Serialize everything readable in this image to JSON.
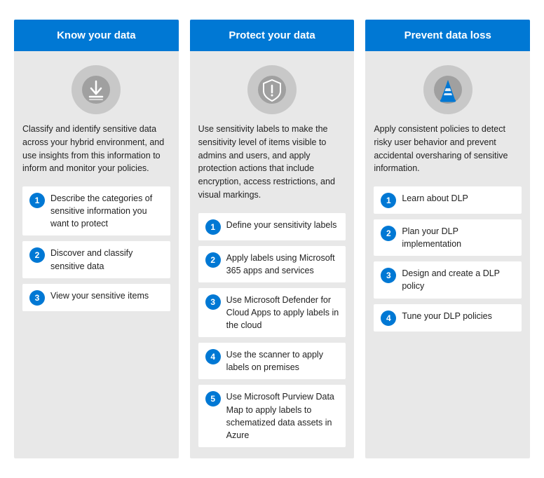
{
  "columns": [
    {
      "id": "know",
      "header": "Know your data",
      "description": "Classify and identify sensitive data across your hybrid environment, and use insights from this information to inform and monitor your policies.",
      "steps": [
        "Describe the categories of sensitive information you want to protect",
        "Discover and classify sensitive data",
        "View your sensitive items"
      ]
    },
    {
      "id": "protect",
      "header": "Protect your data",
      "description": "Use sensitivity labels to make the sensitivity level of items visible to admins and users, and apply protection actions that include encryption, access restrictions, and visual markings.",
      "steps": [
        "Define your sensitivity labels",
        "Apply labels using Microsoft 365 apps and services",
        "Use Microsoft Defender for Cloud Apps to apply labels in the cloud",
        "Use the scanner to apply labels on premises",
        "Use Microsoft Purview Data Map to apply labels to schematized data assets in Azure"
      ]
    },
    {
      "id": "prevent",
      "header": "Prevent data loss",
      "description": "Apply consistent policies to detect risky user behavior and prevent accidental oversharing of sensitive information.",
      "steps": [
        "Learn about DLP",
        "Plan your DLP implementation",
        "Design and create a DLP policy",
        "Tune your DLP policies"
      ]
    }
  ]
}
